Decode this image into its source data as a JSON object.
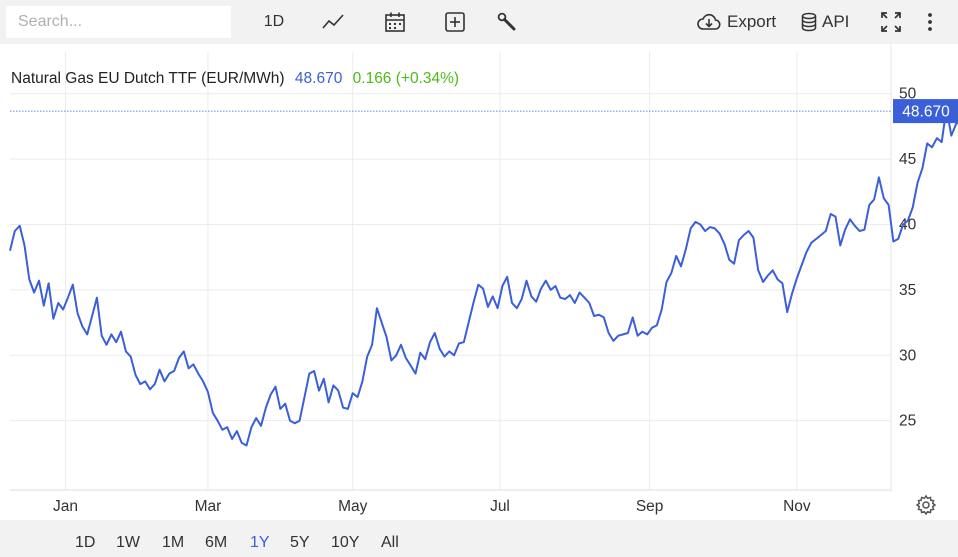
{
  "toolbar": {
    "search_placeholder": "Search...",
    "interval_label": "1D",
    "export_label": "Export",
    "api_label": "API",
    "icons": [
      "line-chart-icon",
      "calendar-icon",
      "add-box-icon",
      "wrench-icon",
      "cloud-download-icon",
      "database-icon",
      "fullscreen-icon",
      "more-vert-icon"
    ]
  },
  "chart_header": {
    "title": "Natural Gas EU Dutch TTF (EUR/MWh)",
    "last": "48.670",
    "change": "0.166 (+0.34%)",
    "last_color": "#3b5fd9",
    "change_color": "#4cbb17"
  },
  "price_tag": "48.670",
  "ranges": {
    "items": [
      "1D",
      "1W",
      "1M",
      "6M",
      "1Y",
      "5Y",
      "10Y",
      "All"
    ],
    "active": "1Y"
  },
  "chart_data": {
    "type": "line",
    "x_unit": "day of year",
    "x_ticks": [
      {
        "label": "Jan",
        "day": 23
      },
      {
        "label": "Mar",
        "day": 82
      },
      {
        "label": "May",
        "day": 142
      },
      {
        "label": "Jul",
        "day": 203
      },
      {
        "label": "Sep",
        "day": 265
      },
      {
        "label": "Nov",
        "day": 326
      }
    ],
    "y_ticks": [
      25,
      30,
      35,
      40,
      45,
      50
    ],
    "ylim": [
      19.7,
      53.8
    ],
    "xlim": [
      0,
      365
    ],
    "grid": true,
    "line_color": "#3b5fd9",
    "last_value": 48.67,
    "series": [
      {
        "points": [
          [
            0,
            38.0
          ],
          [
            2,
            39.5
          ],
          [
            4,
            39.9
          ],
          [
            6,
            38.4
          ],
          [
            8,
            35.8
          ],
          [
            10,
            34.8
          ],
          [
            12,
            35.7
          ],
          [
            14,
            33.8
          ],
          [
            16,
            35.5
          ],
          [
            18,
            32.8
          ],
          [
            20,
            34.0
          ],
          [
            22,
            33.5
          ],
          [
            24,
            34.4
          ],
          [
            26,
            35.4
          ],
          [
            28,
            33.2
          ],
          [
            30,
            32.2
          ],
          [
            32,
            31.6
          ],
          [
            34,
            33.0
          ],
          [
            36,
            34.4
          ],
          [
            38,
            31.5
          ],
          [
            40,
            30.8
          ],
          [
            42,
            31.6
          ],
          [
            44,
            31.0
          ],
          [
            46,
            31.8
          ],
          [
            48,
            30.3
          ],
          [
            50,
            29.9
          ],
          [
            52,
            28.5
          ],
          [
            54,
            27.8
          ],
          [
            56,
            28.0
          ],
          [
            58,
            27.4
          ],
          [
            60,
            27.8
          ],
          [
            62,
            28.9
          ],
          [
            64,
            28.0
          ],
          [
            66,
            28.6
          ],
          [
            68,
            28.8
          ],
          [
            70,
            29.8
          ],
          [
            72,
            30.3
          ],
          [
            74,
            29.0
          ],
          [
            76,
            29.3
          ],
          [
            78,
            28.6
          ],
          [
            80,
            28.0
          ],
          [
            82,
            27.2
          ],
          [
            84,
            25.6
          ],
          [
            86,
            25.0
          ],
          [
            88,
            24.3
          ],
          [
            90,
            24.5
          ],
          [
            92,
            23.6
          ],
          [
            94,
            24.2
          ],
          [
            96,
            23.3
          ],
          [
            98,
            23.1
          ],
          [
            100,
            24.5
          ],
          [
            102,
            25.2
          ],
          [
            104,
            24.6
          ],
          [
            106,
            26.0
          ],
          [
            108,
            27.0
          ],
          [
            110,
            27.6
          ],
          [
            112,
            25.9
          ],
          [
            114,
            26.3
          ],
          [
            116,
            25.0
          ],
          [
            118,
            24.8
          ],
          [
            120,
            25.0
          ],
          [
            122,
            26.8
          ],
          [
            124,
            28.6
          ],
          [
            126,
            28.8
          ],
          [
            128,
            27.3
          ],
          [
            130,
            28.2
          ],
          [
            132,
            26.4
          ],
          [
            134,
            27.7
          ],
          [
            136,
            27.3
          ],
          [
            138,
            26.0
          ],
          [
            140,
            25.9
          ],
          [
            142,
            27.1
          ],
          [
            144,
            26.8
          ],
          [
            146,
            28.0
          ],
          [
            148,
            29.9
          ],
          [
            150,
            30.8
          ],
          [
            152,
            33.6
          ],
          [
            154,
            32.5
          ],
          [
            156,
            31.4
          ],
          [
            158,
            29.6
          ],
          [
            160,
            30.0
          ],
          [
            162,
            30.8
          ],
          [
            164,
            29.8
          ],
          [
            166,
            29.2
          ],
          [
            168,
            28.6
          ],
          [
            170,
            30.2
          ],
          [
            172,
            29.7
          ],
          [
            174,
            31.0
          ],
          [
            176,
            31.7
          ],
          [
            178,
            30.5
          ],
          [
            180,
            29.9
          ],
          [
            182,
            30.3
          ],
          [
            184,
            30.0
          ],
          [
            186,
            30.9
          ],
          [
            188,
            31.0
          ],
          [
            190,
            32.5
          ],
          [
            192,
            34.0
          ],
          [
            194,
            35.4
          ],
          [
            196,
            35.1
          ],
          [
            198,
            33.7
          ],
          [
            200,
            34.5
          ],
          [
            202,
            33.6
          ],
          [
            204,
            35.3
          ],
          [
            206,
            36.0
          ],
          [
            208,
            34.0
          ],
          [
            210,
            33.6
          ],
          [
            212,
            34.3
          ],
          [
            214,
            35.7
          ],
          [
            216,
            34.5
          ],
          [
            218,
            34.1
          ],
          [
            220,
            35.1
          ],
          [
            222,
            35.7
          ],
          [
            224,
            35.0
          ],
          [
            226,
            35.3
          ],
          [
            228,
            34.4
          ],
          [
            230,
            34.3
          ],
          [
            232,
            34.6
          ],
          [
            234,
            34.0
          ],
          [
            236,
            34.8
          ],
          [
            238,
            34.4
          ],
          [
            240,
            34.0
          ],
          [
            242,
            33.0
          ],
          [
            244,
            33.1
          ],
          [
            246,
            32.9
          ],
          [
            248,
            31.7
          ],
          [
            250,
            31.1
          ],
          [
            252,
            31.5
          ],
          [
            254,
            31.6
          ],
          [
            256,
            31.7
          ],
          [
            258,
            32.9
          ],
          [
            260,
            31.5
          ],
          [
            262,
            31.8
          ],
          [
            264,
            31.6
          ],
          [
            266,
            32.1
          ],
          [
            268,
            32.3
          ],
          [
            270,
            33.5
          ],
          [
            272,
            35.6
          ],
          [
            274,
            36.3
          ],
          [
            276,
            37.6
          ],
          [
            278,
            36.8
          ],
          [
            280,
            38.1
          ],
          [
            282,
            39.7
          ],
          [
            284,
            40.2
          ],
          [
            286,
            40.0
          ],
          [
            288,
            39.5
          ],
          [
            290,
            39.8
          ],
          [
            292,
            39.7
          ],
          [
            294,
            39.3
          ],
          [
            296,
            38.5
          ],
          [
            298,
            37.3
          ],
          [
            300,
            37.0
          ],
          [
            302,
            38.8
          ],
          [
            304,
            39.2
          ],
          [
            306,
            39.5
          ],
          [
            308,
            39.0
          ],
          [
            310,
            36.5
          ],
          [
            312,
            35.6
          ],
          [
            314,
            36.1
          ],
          [
            316,
            36.5
          ],
          [
            318,
            35.8
          ],
          [
            320,
            35.5
          ],
          [
            322,
            33.3
          ],
          [
            324,
            34.7
          ],
          [
            326,
            35.9
          ],
          [
            328,
            36.9
          ],
          [
            330,
            37.9
          ],
          [
            332,
            38.6
          ],
          [
            334,
            38.9
          ],
          [
            336,
            39.2
          ],
          [
            338,
            39.5
          ],
          [
            340,
            40.8
          ],
          [
            342,
            40.6
          ],
          [
            344,
            38.4
          ],
          [
            346,
            39.6
          ],
          [
            348,
            40.4
          ],
          [
            350,
            39.9
          ],
          [
            352,
            39.5
          ],
          [
            354,
            39.6
          ],
          [
            356,
            41.5
          ],
          [
            358,
            41.9
          ],
          [
            360,
            43.6
          ],
          [
            362,
            42.0
          ],
          [
            364,
            41.5
          ],
          [
            366,
            38.7
          ],
          [
            368,
            38.9
          ],
          [
            370,
            40.0
          ],
          [
            372,
            40.3
          ],
          [
            374,
            41.3
          ],
          [
            376,
            43.2
          ],
          [
            378,
            44.3
          ],
          [
            380,
            46.2
          ],
          [
            382,
            45.9
          ],
          [
            384,
            46.6
          ],
          [
            386,
            46.3
          ],
          [
            388,
            48.9
          ],
          [
            390,
            46.8
          ],
          [
            392,
            47.7
          ],
          [
            394,
            47.9
          ],
          [
            396,
            46.6
          ],
          [
            398,
            47.0
          ],
          [
            400,
            48.1
          ],
          [
            402,
            48.2
          ],
          [
            404,
            48.67
          ]
        ]
      }
    ]
  }
}
